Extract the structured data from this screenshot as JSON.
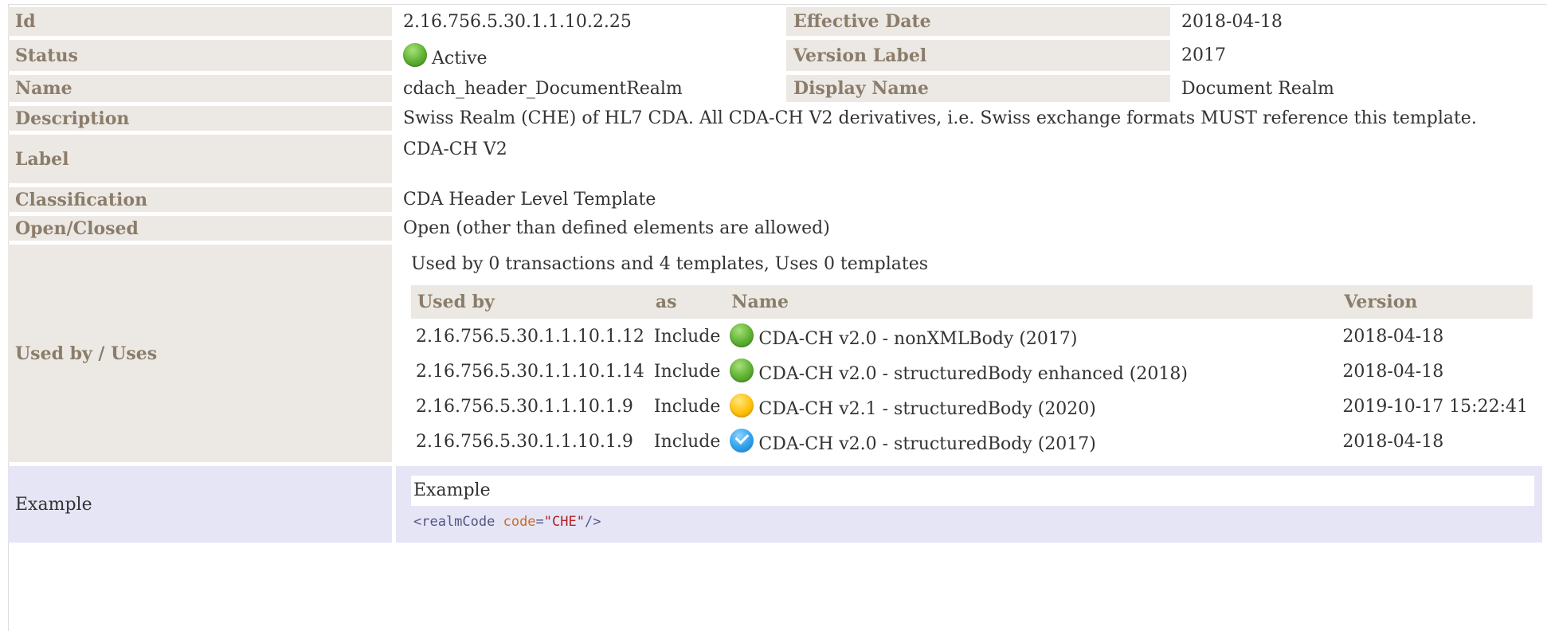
{
  "id": {
    "label": "Id",
    "value": "2.16.756.5.30.1.1.10.2.25"
  },
  "effective_date": {
    "label": "Effective Date",
    "value": "2018-04-18"
  },
  "status": {
    "label": "Status",
    "value": "Active",
    "icon": "status-active-icon",
    "color": "#5cb031"
  },
  "version_label": {
    "label": "Version Label",
    "value": "2017"
  },
  "name": {
    "label": "Name",
    "value": "cdach_header_DocumentRealm"
  },
  "display_name": {
    "label": "Display Name",
    "value": "Document Realm"
  },
  "description": {
    "label": "Description",
    "value": "Swiss Realm (CHE) of HL7 CDA. All CDA-CH V2 derivatives, i.e. Swiss exchange formats MUST reference this template."
  },
  "label_row": {
    "label": "Label",
    "value": "CDA-CH V2"
  },
  "classification": {
    "label": "Classification",
    "value": "CDA Header Level Template"
  },
  "open_closed": {
    "label": "Open/Closed",
    "value": "Open (other than defined elements are allowed)"
  },
  "used_by": {
    "label": "Used by / Uses",
    "summary": "Used by 0 transactions and 4 templates, Uses 0 templates",
    "columns": [
      "Used by",
      "as",
      "Name",
      "Version"
    ],
    "rows": [
      {
        "id": "2.16.756.5.30.1.1.10.1.12",
        "as": "Include",
        "status": "green",
        "name": "CDA-CH v2.0 - nonXMLBody (2017)",
        "version": "2018-04-18"
      },
      {
        "id": "2.16.756.5.30.1.1.10.1.14",
        "as": "Include",
        "status": "green",
        "name": "CDA-CH v2.0 - structuredBody enhanced (2018)",
        "version": "2018-04-18"
      },
      {
        "id": "2.16.756.5.30.1.1.10.1.9",
        "as": "Include",
        "status": "yellow",
        "name": "CDA-CH v2.1 - structuredBody (2020)",
        "version": "2019-10-17 15:22:41"
      },
      {
        "id": "2.16.756.5.30.1.1.10.1.9",
        "as": "Include",
        "status": "blue",
        "name": "CDA-CH v2.0 - structuredBody (2017)",
        "version": "2018-04-18"
      }
    ]
  },
  "example": {
    "label": "Example",
    "title": "Example",
    "code_tag_open": "<realmCode ",
    "code_attr": "code",
    "code_eq": "=",
    "code_val": "\"CHE\"",
    "code_tag_close": "/>"
  },
  "colors": {
    "label_bg": "#ece9e4",
    "label_text": "#8b7d6b",
    "example_bg": "#e5e5f6"
  }
}
